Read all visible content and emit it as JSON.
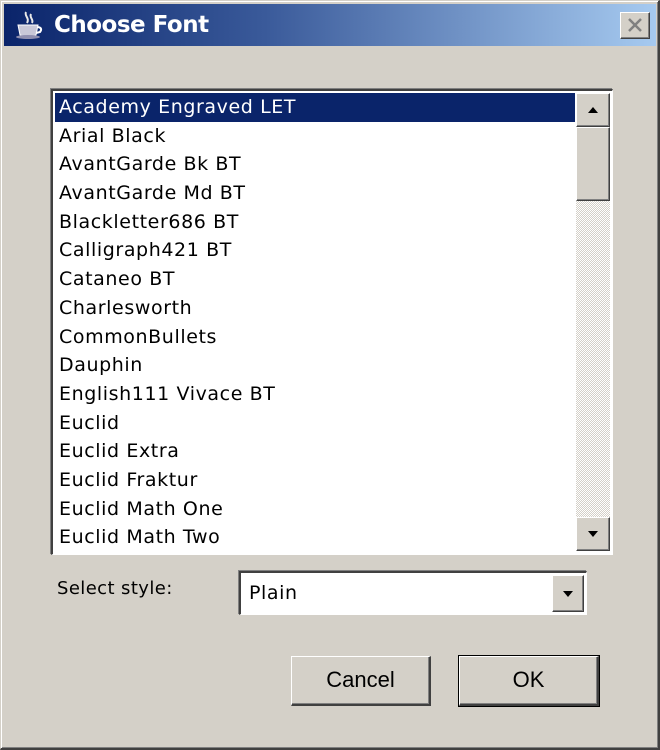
{
  "window": {
    "title": "Choose Font",
    "icon": "java-cup-icon",
    "close_icon": "close-x-icon"
  },
  "font_list": {
    "selected_index": 0,
    "items": [
      "Academy Engraved LET",
      "Arial Black",
      "AvantGarde Bk BT",
      "AvantGarde Md BT",
      "Blackletter686 BT",
      "Calligraph421 BT",
      "Cataneo BT",
      "Charlesworth",
      "CommonBullets",
      "Dauphin",
      "English111 Vivace BT",
      "Euclid",
      "Euclid Extra",
      "Euclid Fraktur",
      "Euclid Math One",
      "Euclid Math Two"
    ],
    "scroll_position": 0.0
  },
  "style": {
    "label": "Select style:",
    "value": "Plain"
  },
  "buttons": {
    "cancel_label": "Cancel",
    "ok_label": "OK"
  },
  "colors": {
    "selection": "#0a246a",
    "title_gradient_start": "#0a246a",
    "title_gradient_end": "#a6caf0",
    "face": "#d4d0c8"
  }
}
